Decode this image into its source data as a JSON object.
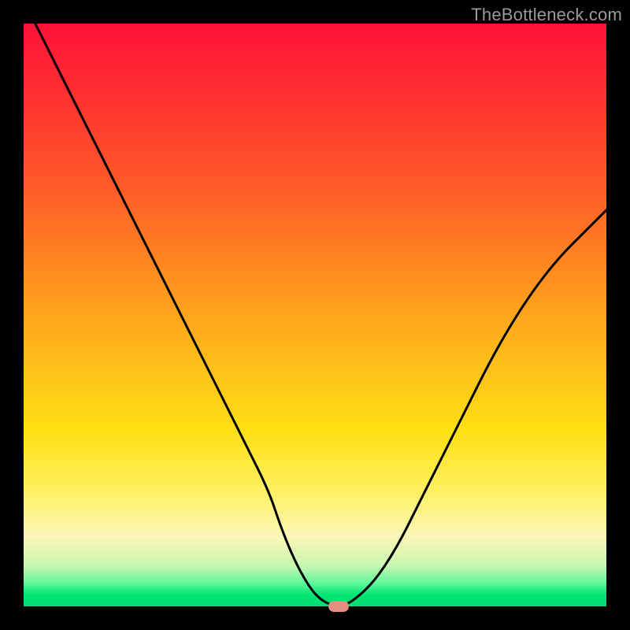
{
  "watermark": "TheBottleneck.com",
  "colors": {
    "frame": "#000000",
    "gradient_top": "#ff1238",
    "gradient_mid1": "#ff8a20",
    "gradient_mid2": "#ffe014",
    "gradient_bottom": "#00e070",
    "curve": "#000000",
    "marker": "#e68e7e",
    "watermark_text": "#9a9a9a"
  },
  "chart_data": {
    "type": "line",
    "title": "",
    "xlabel": "",
    "ylabel": "",
    "xlim": [
      0,
      100
    ],
    "ylim": [
      0,
      100
    ],
    "grid": false,
    "legend": false,
    "series": [
      {
        "name": "bottleneck-curve",
        "x": [
          2,
          6,
          10,
          14,
          18,
          22,
          26,
          30,
          34,
          38,
          42,
          44,
          46,
          48,
          50,
          52,
          54,
          56,
          60,
          64,
          68,
          72,
          76,
          80,
          84,
          88,
          92,
          96,
          100
        ],
        "values": [
          100,
          92,
          84,
          76,
          68,
          60,
          52,
          44,
          36,
          28,
          20,
          14,
          9,
          5,
          2,
          0.5,
          0,
          0.5,
          4,
          10,
          18,
          26,
          34,
          42,
          49,
          55,
          60,
          64,
          68
        ]
      }
    ],
    "annotations": [
      {
        "name": "optimal-marker",
        "x": 54,
        "y": 0,
        "shape": "pill",
        "color": "#e68e7e"
      }
    ]
  }
}
